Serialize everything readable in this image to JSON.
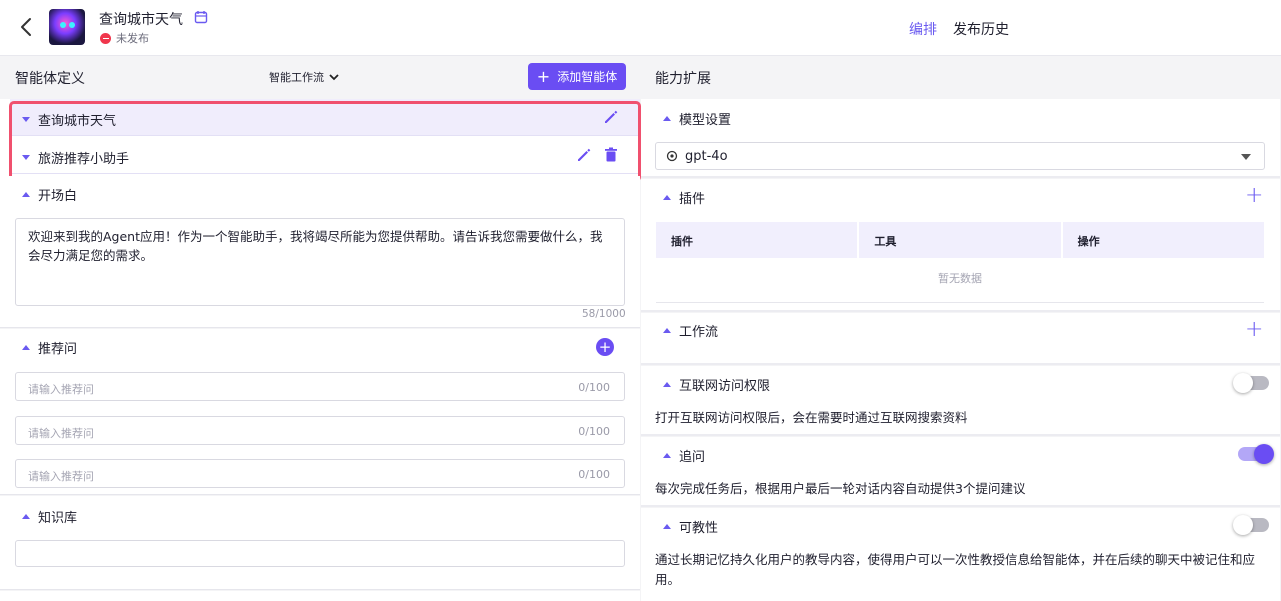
{
  "header": {
    "title": "查询城市天气",
    "status": "未发布",
    "tabs": [
      "编排",
      "发布历史"
    ]
  },
  "left": {
    "title": "智能体定义",
    "workflow_select": "智能工作流",
    "add_agent_button": "添加智能体",
    "agents": [
      "查询城市天气",
      "旅游推荐小助手"
    ],
    "opening": {
      "label": "开场白",
      "text": "欢迎来到我的Agent应用！作为一个智能助手，我将竭尽所能为您提供帮助。请告诉我您需要做什么，我会尽力满足您的需求。",
      "counter": "58/1000"
    },
    "suggestions": {
      "label": "推荐问",
      "placeholder": "请输入推荐问",
      "counter": "0/100"
    },
    "knowledge": {
      "label": "知识库"
    }
  },
  "right": {
    "title": "能力扩展",
    "model": {
      "label": "模型设置",
      "value": "gpt-4o"
    },
    "plugins": {
      "label": "插件",
      "columns": [
        "插件",
        "工具",
        "操作"
      ],
      "empty": "暂无数据"
    },
    "workflow": {
      "label": "工作流"
    },
    "internet": {
      "label": "互联网访问权限",
      "desc": "打开互联网访问权限后，会在需要时通过互联网搜索资料",
      "enabled": false
    },
    "followup": {
      "label": "追问",
      "desc": "每次完成任务后，根据用户最后一轮对话内容自动提供3个提问建议",
      "enabled": true
    },
    "teachable": {
      "label": "可教性",
      "desc": "通过长期记忆持久化用户的教导内容，使得用户可以一次性教授信息给智能体，并在后续的聊天中被记住和应用。",
      "enabled": false
    }
  },
  "colors": {
    "accent": "#6a4df3",
    "highlight_border": "#f0506e",
    "unpublished": "#f0364c"
  }
}
